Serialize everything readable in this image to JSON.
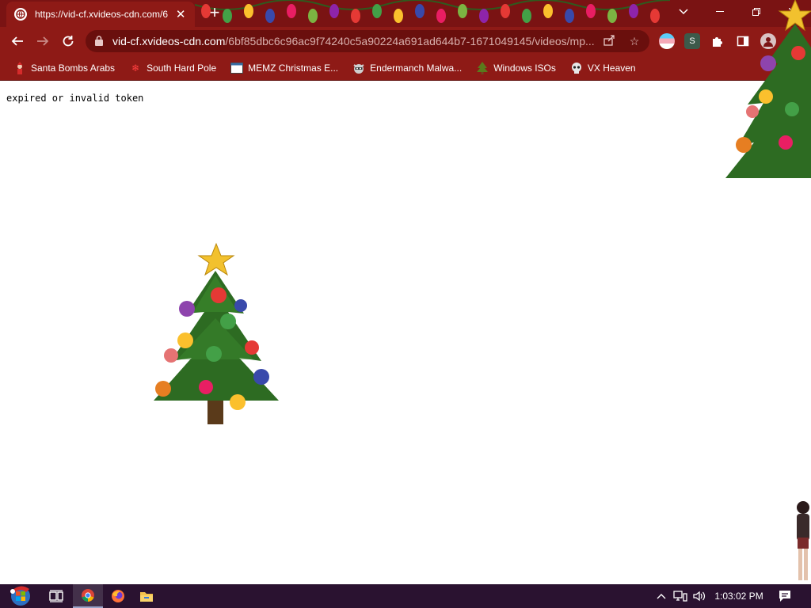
{
  "colors": {
    "frame": "#7a1313",
    "toolbar": "#8e1a16",
    "omnibox": "#6a0f0d",
    "url_path": "#d9b0ad",
    "taskbar": "#2a1230",
    "page_bg": "#ffffff"
  },
  "tab": {
    "title": "https://vid-cf.xvideos-cdn.com/6",
    "favicon": "globe-icon",
    "close_icon": "close-icon"
  },
  "newtab_icon": "plus-icon",
  "window_controls": [
    "chevron-down-icon",
    "minimize-icon",
    "restore-icon",
    "close-icon"
  ],
  "nav": {
    "back_icon": "arrow-left-icon",
    "forward_icon": "arrow-right-icon",
    "reload_icon": "reload-icon"
  },
  "address": {
    "host": "vid-cf.xvideos-cdn.com",
    "path": "/6bf85dbc6c96ac9f74240c5a90224a691ad644b7-1671049145/videos/mp...",
    "icons": [
      "share-icon",
      "star-icon"
    ]
  },
  "extensions": [
    "flag-extension-icon",
    "s-extension-icon",
    "puzzle-icon",
    "sidepanel-icon",
    "profile-icon"
  ],
  "ext_s_label": "S",
  "bookmarks": [
    {
      "label": "Santa Bombs Arabs",
      "icon": "santa-icon"
    },
    {
      "label": "South Hard Pole",
      "icon": "snowflake-icon"
    },
    {
      "label": "MEMZ Christmas E...",
      "icon": "window-icon"
    },
    {
      "label": "Endermanch Malwa...",
      "icon": "raccoon-icon"
    },
    {
      "label": "Windows ISOs",
      "icon": "tree-icon"
    },
    {
      "label": "VX Heaven",
      "icon": "skull-icon"
    }
  ],
  "page": {
    "message": "expired or invalid token"
  },
  "taskbar": {
    "start_icon": "start-orb-icon",
    "apps": [
      "task-view-icon",
      "chrome-icon",
      "firefox-icon",
      "file-explorer-icon"
    ],
    "tray_icons": [
      "tray-chevron-icon",
      "network-icon",
      "volume-icon"
    ],
    "clock": "1:03:02 PM",
    "notification_icon": "notification-icon"
  }
}
